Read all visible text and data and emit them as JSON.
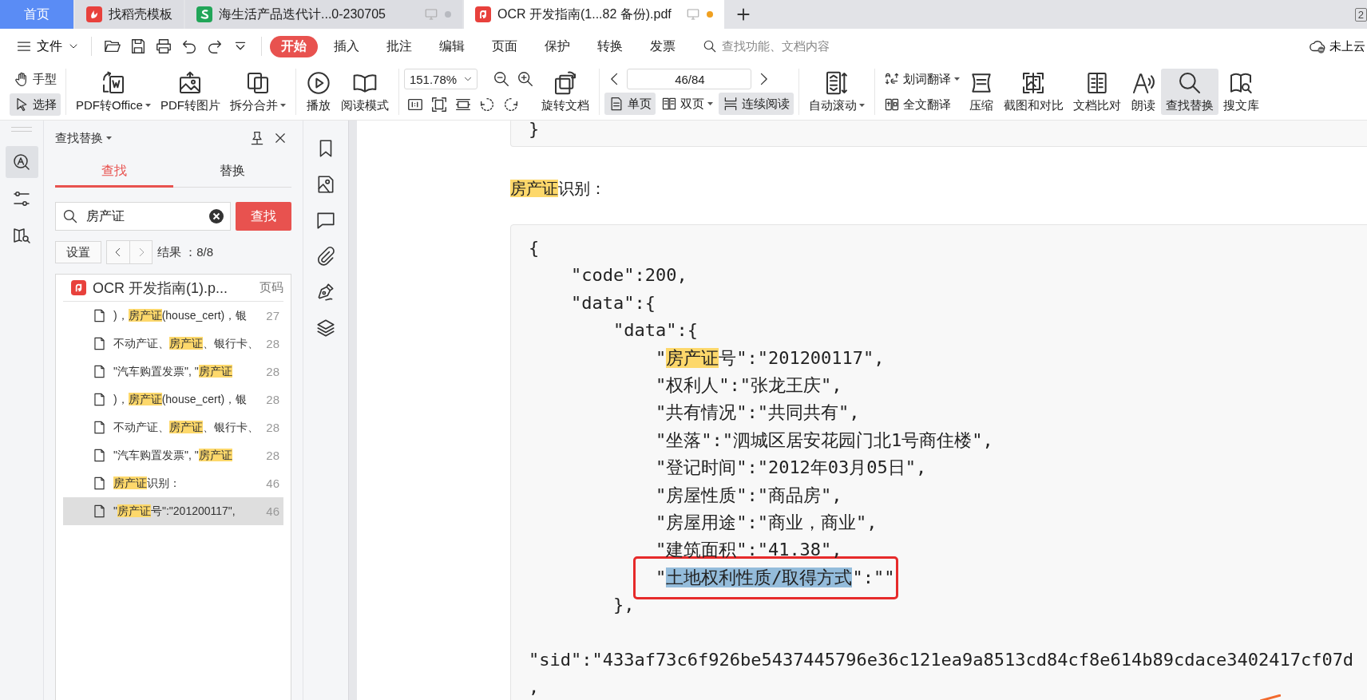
{
  "tabs": [
    {
      "kind": "home",
      "label": "首页",
      "selected": false,
      "modified": false
    },
    {
      "kind": "docer",
      "label": "找稻壳模板",
      "selected": false,
      "modified": false
    },
    {
      "kind": "sheet",
      "label": "海生活产品迭代计...0-230705",
      "selected": false,
      "modified": false
    },
    {
      "kind": "pdf",
      "label": "OCR 开发指南(1...82 备份).pdf",
      "selected": true,
      "modified": true
    }
  ],
  "window_count": "2",
  "menu": {
    "file": "文件",
    "items": [
      {
        "label": "开始",
        "selected": true
      },
      {
        "label": "插入",
        "selected": false
      },
      {
        "label": "批注",
        "selected": false
      },
      {
        "label": "编辑",
        "selected": false
      },
      {
        "label": "页面",
        "selected": false
      },
      {
        "label": "保护",
        "selected": false
      },
      {
        "label": "转换",
        "selected": false
      },
      {
        "label": "发票",
        "selected": false
      }
    ],
    "search_placeholder": "查找功能、文档内容",
    "cloud": "未上云"
  },
  "toolbar": {
    "pointer_modes": [
      {
        "kind": "hand",
        "label": "手型",
        "selected": false
      },
      {
        "kind": "select",
        "label": "选择",
        "selected": true
      }
    ],
    "convert": [
      {
        "kind": "pdf-office",
        "label": "PDF转Office",
        "dropdown": true
      },
      {
        "kind": "pdf-image",
        "label": "PDF转图片",
        "dropdown": false
      },
      {
        "kind": "split-merge",
        "label": "拆分合并",
        "dropdown": true
      }
    ],
    "reading": [
      {
        "kind": "play",
        "label": "播放"
      },
      {
        "kind": "read-mode",
        "label": "阅读模式"
      }
    ],
    "zoom": {
      "value": "151.78%"
    },
    "rotate": {
      "label": "旋转文档"
    },
    "page": {
      "value": "46/84"
    },
    "view_modes": [
      {
        "kind": "single",
        "label": "单页",
        "selected": true,
        "dropdown": false
      },
      {
        "kind": "double",
        "label": "双页",
        "selected": false,
        "dropdown": true
      },
      {
        "kind": "continuous",
        "label": "连续阅读",
        "selected": true,
        "dropdown": false
      }
    ],
    "auto_scroll": {
      "label": "自动滚动",
      "dropdown": true
    },
    "translate": [
      {
        "kind": "word",
        "label": "划词翻译",
        "dropdown": true
      },
      {
        "kind": "full",
        "label": "全文翻译",
        "dropdown": false
      }
    ],
    "tools": [
      {
        "kind": "compress",
        "label": "压缩",
        "selected": false
      },
      {
        "kind": "screenshot",
        "label": "截图和对比",
        "selected": false
      },
      {
        "kind": "compare",
        "label": "文档比对",
        "selected": false
      },
      {
        "kind": "read-aloud",
        "label": "朗读",
        "selected": false
      },
      {
        "kind": "find",
        "label": "查找替换",
        "selected": true
      },
      {
        "kind": "library",
        "label": "搜文库",
        "selected": false
      }
    ]
  },
  "rail": [
    {
      "kind": "find",
      "selected": true
    },
    {
      "kind": "settings",
      "selected": false
    },
    {
      "kind": "book-search",
      "selected": false
    }
  ],
  "find_panel": {
    "title": "查找替换",
    "tabs": [
      {
        "label": "查找",
        "selected": true
      },
      {
        "label": "替换",
        "selected": false
      }
    ],
    "query": "房产证",
    "find_button": "查找",
    "settings_button": "设置",
    "result_count": "结果 ：8/8",
    "file": "OCR 开发指南(1).p...",
    "page_header": "页码",
    "results": [
      {
        "parts": [
          {
            "text": ")，",
            "match": false
          },
          {
            "text": "房产证",
            "match": true
          },
          {
            "text": "(house_cert)，银",
            "match": false
          }
        ],
        "page": "27",
        "selected": false
      },
      {
        "parts": [
          {
            "text": "不动产证、",
            "match": false
          },
          {
            "text": "房产证",
            "match": true
          },
          {
            "text": "、银行卡、",
            "match": false
          }
        ],
        "page": "28",
        "selected": false
      },
      {
        "parts": [
          {
            "text": "\"汽车购置发票\", \"",
            "match": false
          },
          {
            "text": "房产证",
            "match": true
          }
        ],
        "page": "28",
        "selected": false
      },
      {
        "parts": [
          {
            "text": ")，",
            "match": false
          },
          {
            "text": "房产证",
            "match": true
          },
          {
            "text": "(house_cert)，银",
            "match": false
          }
        ],
        "page": "28",
        "selected": false
      },
      {
        "parts": [
          {
            "text": "不动产证、",
            "match": false
          },
          {
            "text": "房产证",
            "match": true
          },
          {
            "text": "、银行卡、",
            "match": false
          }
        ],
        "page": "28",
        "selected": false
      },
      {
        "parts": [
          {
            "text": "\"汽车购置发票\", \"",
            "match": false
          },
          {
            "text": "房产证",
            "match": true
          }
        ],
        "page": "28",
        "selected": false
      },
      {
        "parts": [
          {
            "text": "房产证",
            "match": true
          },
          {
            "text": "识别：",
            "match": false
          }
        ],
        "page": "46",
        "selected": false
      },
      {
        "parts": [
          {
            "text": "\"",
            "match": false
          },
          {
            "text": "房产证",
            "match": true
          },
          {
            "text": "号\":\"201200117\",",
            "match": false
          }
        ],
        "page": "46",
        "selected": true
      }
    ]
  },
  "side_icons": [
    {
      "kind": "bookmark"
    },
    {
      "kind": "image"
    },
    {
      "kind": "comment"
    },
    {
      "kind": "attachment"
    },
    {
      "kind": "signature"
    },
    {
      "kind": "layers"
    }
  ],
  "document": {
    "previous_block": "}",
    "heading": [
      {
        "text": "房产证",
        "match": true,
        "selected": false
      },
      {
        "text": "识别：",
        "match": false,
        "selected": false
      }
    ],
    "code": [
      {
        "parts": [
          {
            "text": "{",
            "match": false,
            "selected": false
          }
        ],
        "annotated": false,
        "blank_line_before": false,
        "children": [
          {
            "parts": [
              {
                "text": "\"code\":200,",
                "match": false,
                "selected": false
              }
            ],
            "annotated": false,
            "blank_line_before": false
          },
          {
            "parts": [
              {
                "text": "\"data\":{",
                "match": false,
                "selected": false
              }
            ],
            "annotated": false,
            "blank_line_before": false,
            "children": [
              {
                "parts": [
                  {
                    "text": "\"data\":{",
                    "match": false,
                    "selected": false
                  }
                ],
                "annotated": false,
                "blank_line_before": false,
                "children": [
                  {
                    "parts": [
                      {
                        "text": "\"",
                        "match": false,
                        "selected": false
                      },
                      {
                        "text": "房产证",
                        "match": true,
                        "selected": false
                      },
                      {
                        "text": "号\":\"201200117\",",
                        "match": false,
                        "selected": false
                      }
                    ],
                    "annotated": false,
                    "blank_line_before": false
                  },
                  {
                    "parts": [
                      {
                        "text": "\"权利人\":\"张龙王庆\",",
                        "match": false,
                        "selected": false
                      }
                    ],
                    "annotated": false,
                    "blank_line_before": false
                  },
                  {
                    "parts": [
                      {
                        "text": "\"共有情况\":\"共同共有\",",
                        "match": false,
                        "selected": false
                      }
                    ],
                    "annotated": false,
                    "blank_line_before": false
                  },
                  {
                    "parts": [
                      {
                        "text": "\"坐落\":\"泗城区居安花园门北1号商住楼\",",
                        "match": false,
                        "selected": false
                      }
                    ],
                    "annotated": false,
                    "blank_line_before": false
                  },
                  {
                    "parts": [
                      {
                        "text": "\"登记时间\":\"2012年03月05日\",",
                        "match": false,
                        "selected": false
                      }
                    ],
                    "annotated": false,
                    "blank_line_before": false
                  },
                  {
                    "parts": [
                      {
                        "text": "\"房屋性质\":\"商品房\",",
                        "match": false,
                        "selected": false
                      }
                    ],
                    "annotated": false,
                    "blank_line_before": false
                  },
                  {
                    "parts": [
                      {
                        "text": "\"房屋用途\":\"商业，商业\",",
                        "match": false,
                        "selected": false
                      }
                    ],
                    "annotated": false,
                    "blank_line_before": false
                  },
                  {
                    "parts": [
                      {
                        "text": "\"建筑面积\":\"41.38\",",
                        "match": false,
                        "selected": false
                      }
                    ],
                    "annotated": false,
                    "blank_line_before": false
                  },
                  {
                    "parts": [
                      {
                        "text": "\"",
                        "match": false,
                        "selected": false
                      },
                      {
                        "text": "土地权利性质/取得方式",
                        "match": false,
                        "selected": true
                      },
                      {
                        "text": "\":\"\"",
                        "match": false,
                        "selected": false
                      }
                    ],
                    "annotated": true,
                    "blank_line_before": false
                  }
                ]
              },
              {
                "parts": [
                  {
                    "text": "},",
                    "match": false,
                    "selected": false
                  }
                ],
                "annotated": false,
                "blank_line_before": false
              }
            ]
          }
        ]
      },
      {
        "parts": [
          {
            "text": "\"sid\":\"433af73c6f926be5437445796e36c121ea9a8513cd84cf8e614b89cdace3402417cf07d",
            "match": false,
            "selected": false
          }
        ],
        "annotated": false,
        "blank_line_before": true
      },
      {
        "parts": [
          {
            "text": ",",
            "match": false,
            "selected": false
          }
        ],
        "annotated": false,
        "blank_line_before": false
      }
    ]
  }
}
